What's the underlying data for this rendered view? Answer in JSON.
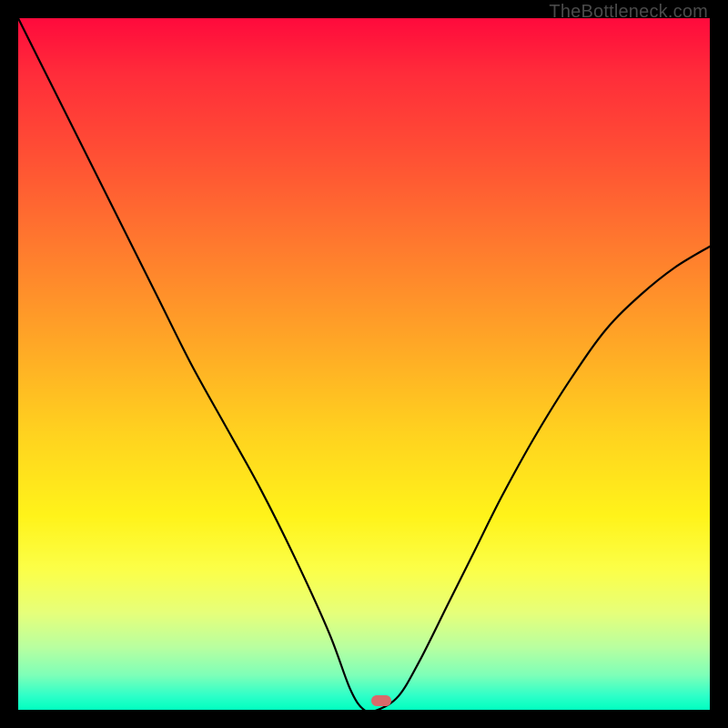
{
  "watermark": "TheBottleneck.com",
  "marker": {
    "color": "#d86a6a",
    "x_norm": 0.525,
    "y_norm": 0.01
  },
  "chart_data": {
    "type": "line",
    "title": "",
    "xlabel": "",
    "ylabel": "",
    "xlim": [
      0,
      1
    ],
    "ylim": [
      0,
      1
    ],
    "grid": false,
    "legend": false,
    "annotations": [
      "TheBottleneck.com"
    ],
    "series": [
      {
        "name": "bottleneck-curve",
        "x": [
          0.0,
          0.05,
          0.1,
          0.15,
          0.2,
          0.25,
          0.3,
          0.35,
          0.4,
          0.45,
          0.48,
          0.5,
          0.52,
          0.55,
          0.58,
          0.62,
          0.66,
          0.7,
          0.75,
          0.8,
          0.85,
          0.9,
          0.95,
          1.0
        ],
        "y": [
          1.0,
          0.9,
          0.8,
          0.7,
          0.6,
          0.5,
          0.41,
          0.32,
          0.22,
          0.11,
          0.03,
          0.0,
          0.0,
          0.02,
          0.07,
          0.15,
          0.23,
          0.31,
          0.4,
          0.48,
          0.55,
          0.6,
          0.64,
          0.67
        ]
      }
    ],
    "optimal_point": {
      "x": 0.525,
      "y": 0.0
    }
  }
}
